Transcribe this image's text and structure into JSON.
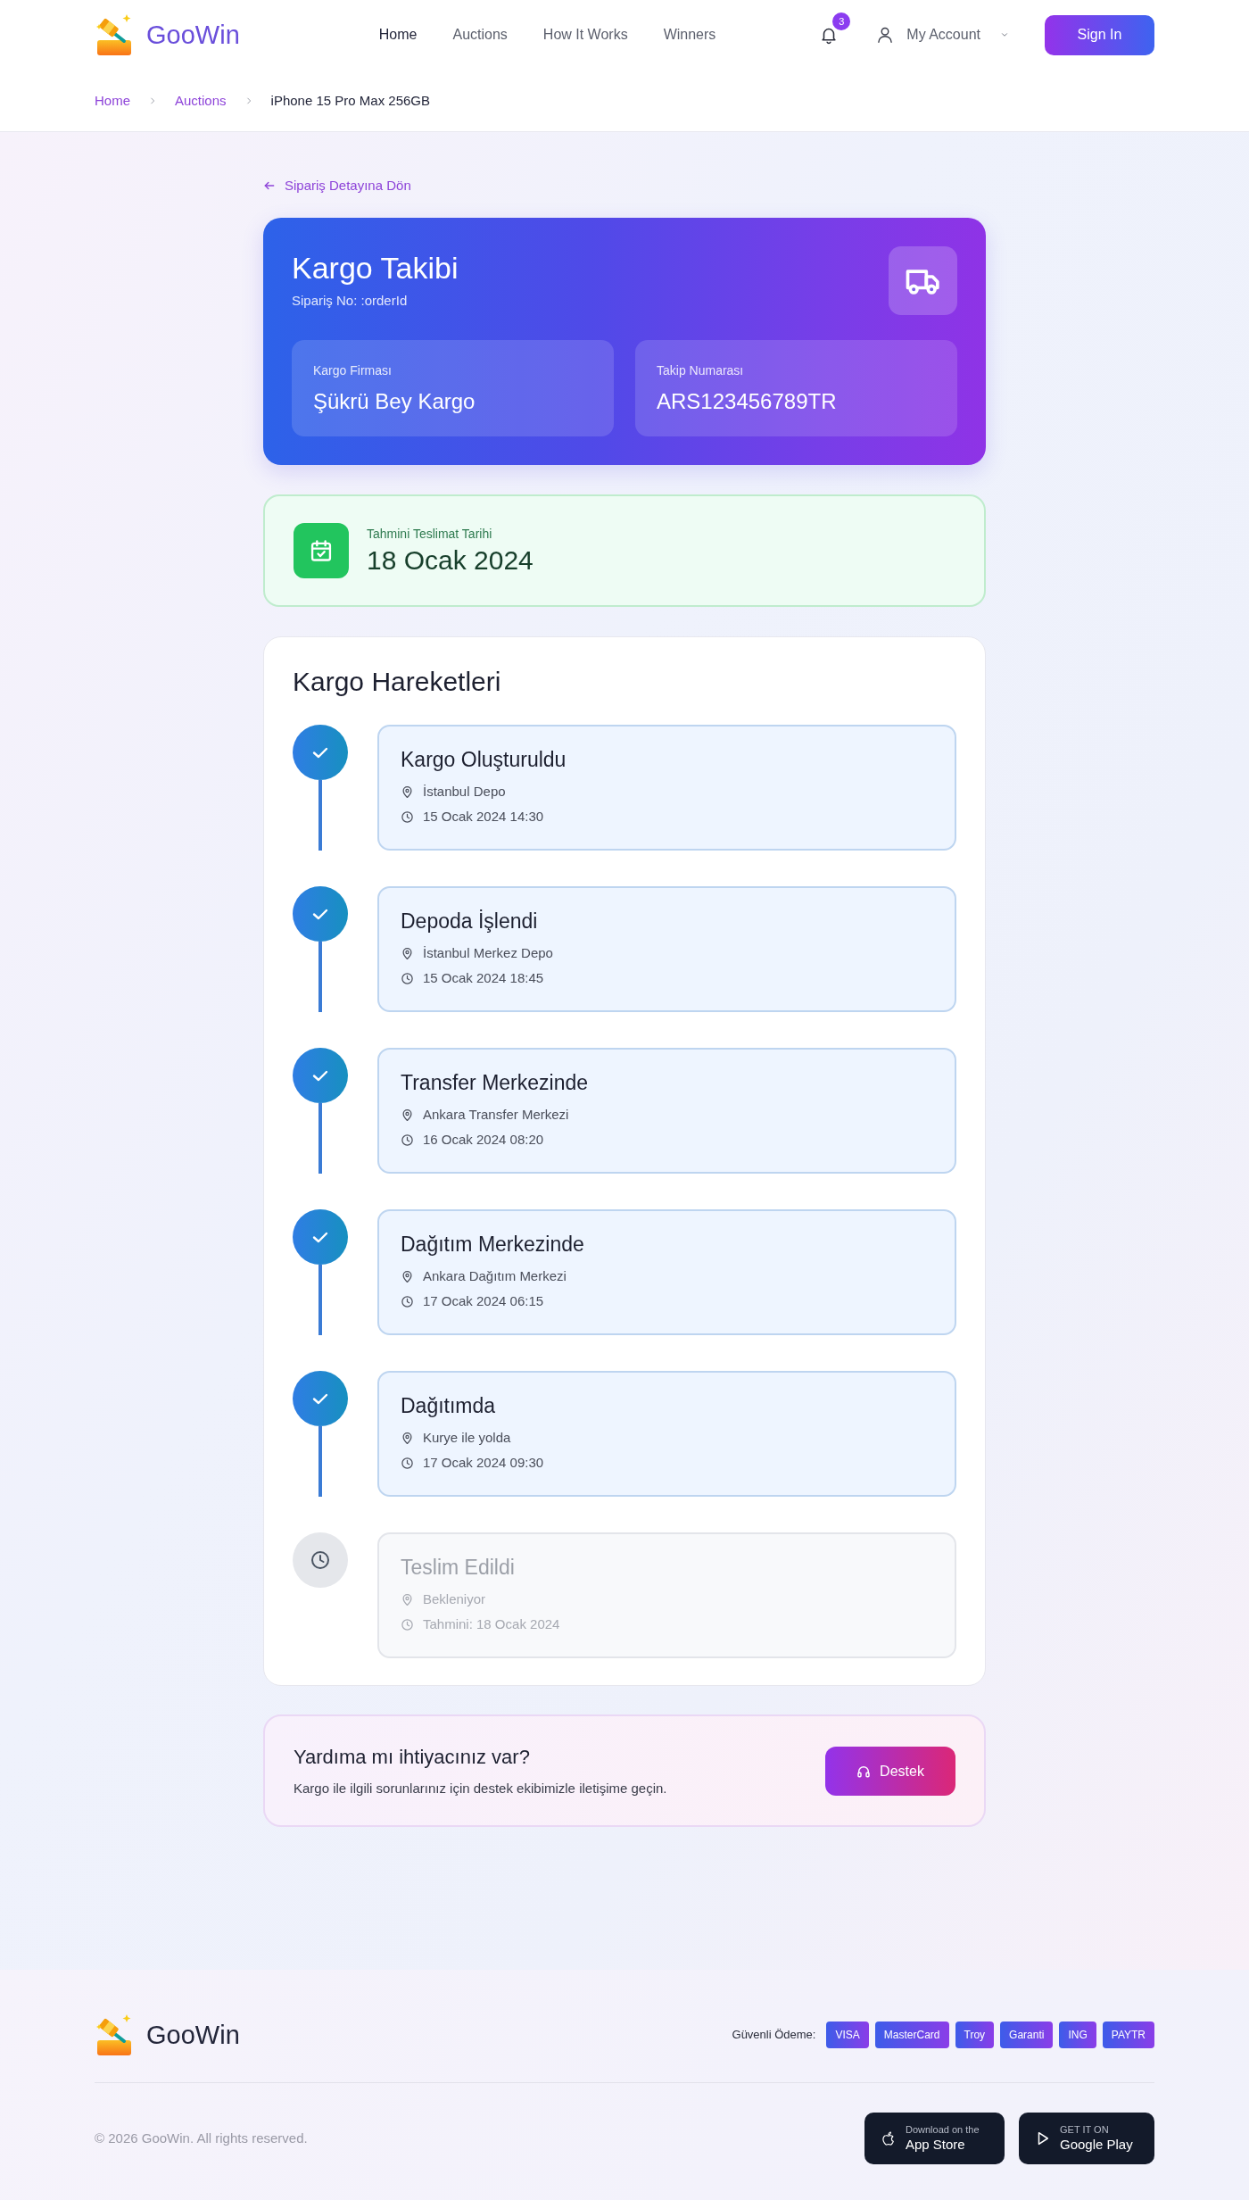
{
  "header": {
    "brand": "GooWin",
    "nav": [
      {
        "label": "Home",
        "selected": true
      },
      {
        "label": "Auctions",
        "selected": false
      },
      {
        "label": "How It Works",
        "selected": false
      },
      {
        "label": "Winners",
        "selected": false
      }
    ],
    "notifications": {
      "count": "3"
    },
    "account": {
      "label": "My Account"
    },
    "sign_in": "Sign In"
  },
  "breadcrumb": [
    {
      "label": "Home"
    },
    {
      "label": "Auctions"
    },
    {
      "label": "iPhone 15 Pro Max 256GB"
    }
  ],
  "back_link": "Sipariş Detayına Dön",
  "tracking": {
    "title": "Kargo Takibi",
    "order_no": "Sipariş No: :orderId",
    "fields": [
      {
        "label": "Kargo Firması",
        "value": "Şükrü Bey Kargo"
      },
      {
        "label": "Takip Numarası",
        "value": "ARS123456789TR"
      }
    ]
  },
  "estimated_delivery": {
    "label": "Tahmini Teslimat Tarihi",
    "date": "18 Ocak 2024"
  },
  "movements": {
    "title": "Kargo Hareketleri",
    "events": [
      {
        "title": "Kargo Oluşturuldu",
        "location": "İstanbul Depo",
        "time": "15 Ocak 2024 14:30",
        "completed": true
      },
      {
        "title": "Depoda İşlendi",
        "location": "İstanbul Merkez Depo",
        "time": "15 Ocak 2024 18:45",
        "completed": true
      },
      {
        "title": "Transfer Merkezinde",
        "location": "Ankara Transfer Merkezi",
        "time": "16 Ocak 2024 08:20",
        "completed": true
      },
      {
        "title": "Dağıtım Merkezinde",
        "location": "Ankara Dağıtım Merkezi",
        "time": "17 Ocak 2024 06:15",
        "completed": true
      },
      {
        "title": "Dağıtımda",
        "location": "Kurye ile yolda",
        "time": "17 Ocak 2024 09:30",
        "completed": true
      },
      {
        "title": "Teslim Edildi",
        "location": "Bekleniyor",
        "time": "Tahmini: 18 Ocak 2024",
        "completed": false
      }
    ]
  },
  "help": {
    "title": "Yardıma mı ihtiyacınız var?",
    "text": "Kargo ile ilgili sorunlarınız için destek ekibimizle iletişime geçin.",
    "button": "Destek"
  },
  "footer": {
    "brand": "GooWin",
    "payment_label": "Güvenli Ödeme:",
    "payment_methods": [
      "VISA",
      "MasterCard",
      "Troy",
      "Garanti",
      "ING",
      "PAYTR"
    ],
    "copyright": "© 2026 GooWin. All rights reserved.",
    "stores": [
      {
        "kind": "apple",
        "caption": "Download on the",
        "name": "App Store"
      },
      {
        "kind": "google",
        "caption": "GET IT ON",
        "name": "Google Play"
      }
    ]
  }
}
